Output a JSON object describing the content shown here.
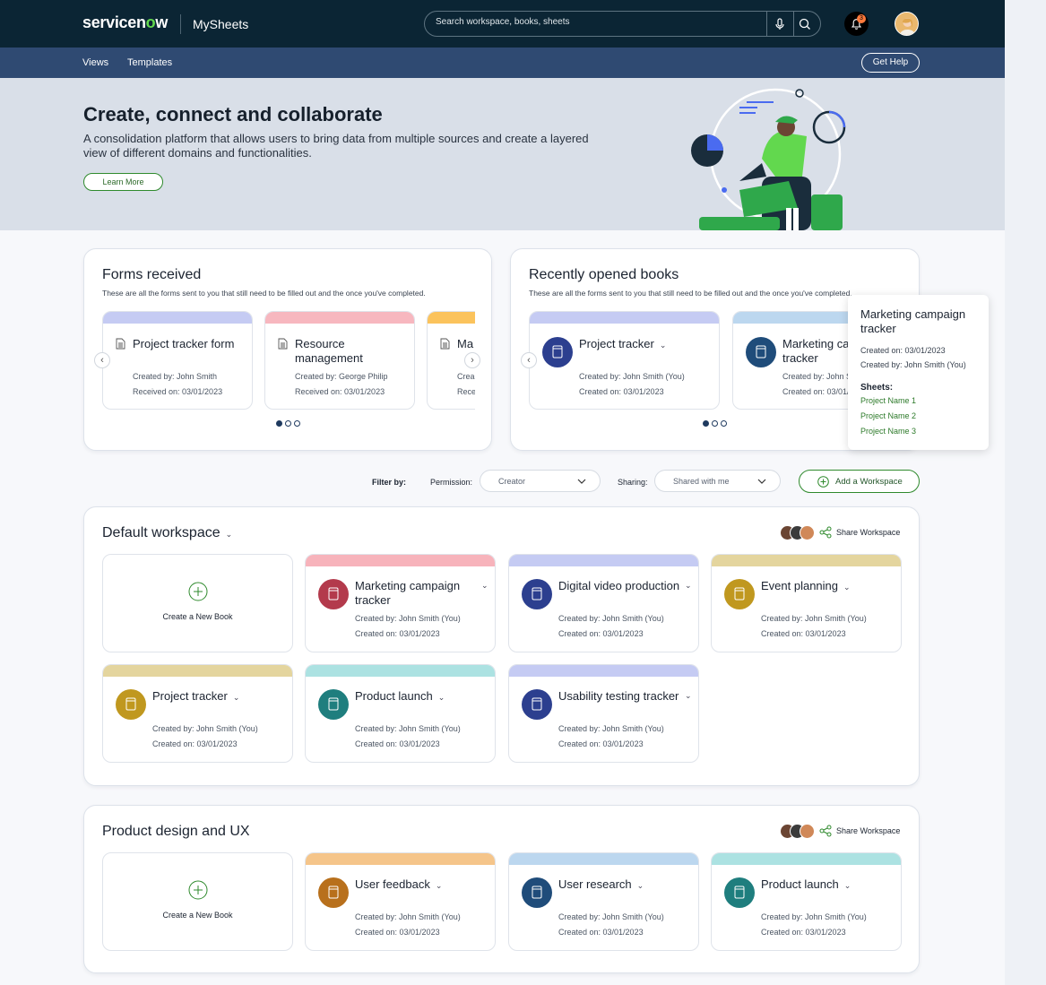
{
  "header": {
    "logo_text_a": "servicen",
    "logo_text_o": "o",
    "logo_text_b": "w",
    "app_name": "MySheets",
    "search_placeholder": "Search workspace, books, sheets",
    "notification_count": "3"
  },
  "subnav": {
    "views": "Views",
    "templates": "Templates",
    "get_help": "Get Help"
  },
  "hero": {
    "title": "Create, connect and collaborate",
    "description": "A consolidation platform that allows users to bring data from multiple sources and create a layered view of different domains and functionalities.",
    "cta": "Learn More"
  },
  "forms_received": {
    "title": "Forms received",
    "description": "These are all the forms sent to you that still need to be filled out and the once you've completed.",
    "items": [
      {
        "title": "Project tracker form",
        "created": "Created by: John Smith",
        "received": "Received on: 03/01/2023",
        "color": "#c5cbf3"
      },
      {
        "title": "Resource management",
        "created": "Created by: George Philip",
        "received": "Received on: 03/01/2023",
        "color": "#f7b7bf"
      },
      {
        "title": "Ma c",
        "created": "Crea",
        "received": "Rece",
        "color": "#fbc35c"
      }
    ]
  },
  "recent_books": {
    "title": "Recently opened books",
    "description": "These are all the forms sent to you that still need to be filled out and the once you've completed.",
    "items": [
      {
        "title": "Project tracker",
        "created": "Created by: John Smith (You)",
        "date": "Created on: 03/01/2023",
        "color": "#c5cbf3",
        "icon": "#2c3f8f"
      },
      {
        "title": "Marketing campaign tracker",
        "created": "Created by: John Smith (You)",
        "date": "Created on: 03/01/2023",
        "color": "#bcd7ef",
        "icon": "#1f4c7a"
      }
    ]
  },
  "tooltip": {
    "title": "Marketing campaign tracker",
    "created_on": "Created on: 03/01/2023",
    "created_by": "Created by: John Smith (You)",
    "sheets_label": "Sheets:",
    "sheets": [
      "Project Name 1",
      "Project Name 2",
      "Project Name 3"
    ]
  },
  "filters": {
    "filter_by": "Filter by:",
    "permission_label": "Permission:",
    "permission_value": "Creator",
    "sharing_label": "Sharing:",
    "sharing_value": "Shared with me",
    "add_workspace": "Add a Workspace"
  },
  "workspace_default": {
    "title": "Default workspace",
    "share": "Share Workspace",
    "new_book": "Create a New Book",
    "books": [
      {
        "title": "Marketing campaign tracker",
        "created": "Created by: John Smith (You)",
        "date": "Created on: 03/01/2023",
        "strip": "#f7b3bb",
        "icon": "#b33a4c"
      },
      {
        "title": "Digital video production",
        "created": "Created by: John Smith (You)",
        "date": "Created on: 03/01/2023",
        "strip": "#c5cbf3",
        "icon": "#2c3f8f"
      },
      {
        "title": "Event planning",
        "created": "Created by: John Smith (You)",
        "date": "Created on: 03/01/2023",
        "strip": "#e4d59e",
        "icon": "#c0981f"
      },
      {
        "title": "Project tracker",
        "created": "Created by: John Smith (You)",
        "date": "Created on: 03/01/2023",
        "strip": "#e4d59e",
        "icon": "#c0981f"
      },
      {
        "title": "Product launch",
        "created": "Created by: John Smith (You)",
        "date": "Created on: 03/01/2023",
        "strip": "#ace2e2",
        "icon": "#1f7e7e"
      },
      {
        "title": "Usability testing tracker",
        "created": "Created by: John Smith (You)",
        "date": "Created on: 03/01/2023",
        "strip": "#c5cbf3",
        "icon": "#2c3f8f"
      }
    ]
  },
  "workspace_design": {
    "title": "Product design and UX",
    "share": "Share Workspace",
    "new_book": "Create a New Book",
    "books": [
      {
        "title": "User feedback",
        "created": "Created by: John Smith (You)",
        "date": "Created on: 03/01/2023",
        "strip": "#f5c58a",
        "icon": "#b8701c"
      },
      {
        "title": "User research",
        "created": "Created by: John Smith (You)",
        "date": "Created on: 03/01/2023",
        "strip": "#bcd7ef",
        "icon": "#1f4c7a"
      },
      {
        "title": "Product launch",
        "created": "Created by: John Smith (You)",
        "date": "Created on: 03/01/2023",
        "strip": "#ace2e2",
        "icon": "#1f7e7e"
      }
    ]
  }
}
